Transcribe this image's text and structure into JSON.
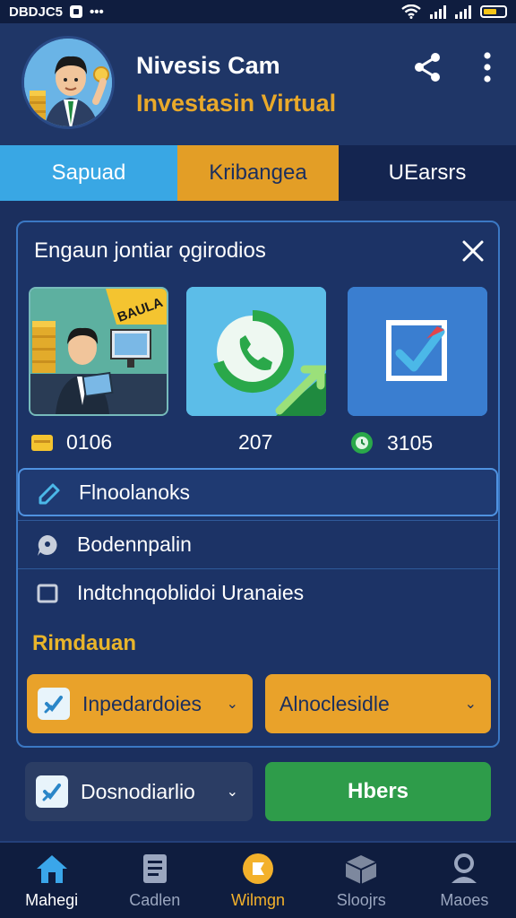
{
  "status_bar": {
    "left_text": "DBDJC5",
    "menu_dots": "•••"
  },
  "header": {
    "title": "Nivesis Cam",
    "subtitle": "Investasin Virtual"
  },
  "tabs": [
    {
      "label": "Sapuad"
    },
    {
      "label": "Kribangea"
    },
    {
      "label": "UEarsrs"
    }
  ],
  "panel": {
    "title": "Engaun jontiar ǫgirodios",
    "cards": [
      {
        "label": "BAULA"
      }
    ],
    "stats": [
      "0106",
      "207",
      "3105"
    ],
    "rows": [
      {
        "label": "Flnoolanoks"
      },
      {
        "label": "Bodennpalin"
      },
      {
        "label": "Indtchnqoblidoi Uranaies"
      }
    ],
    "section_label": "Rimdauan",
    "dropdowns": [
      {
        "label": "Inpedardoies",
        "chevron": "⌄"
      },
      {
        "label": "Alnoclesidle",
        "chevron": "⌄"
      }
    ]
  },
  "bottom_controls": {
    "dropdown": {
      "label": "Dosnodiarlio",
      "chevron": "⌄"
    },
    "button_label": "Hbers"
  },
  "bottom_nav": [
    {
      "label": "Mahegi"
    },
    {
      "label": "Cadlen"
    },
    {
      "label": "Wilmgn"
    },
    {
      "label": "Sloojrs"
    },
    {
      "label": "Maoes"
    }
  ],
  "colors": {
    "accent_orange": "#e9a22a",
    "accent_blue": "#39a7e4",
    "success_green": "#2e9c4a",
    "background": "#1b2f5e"
  }
}
